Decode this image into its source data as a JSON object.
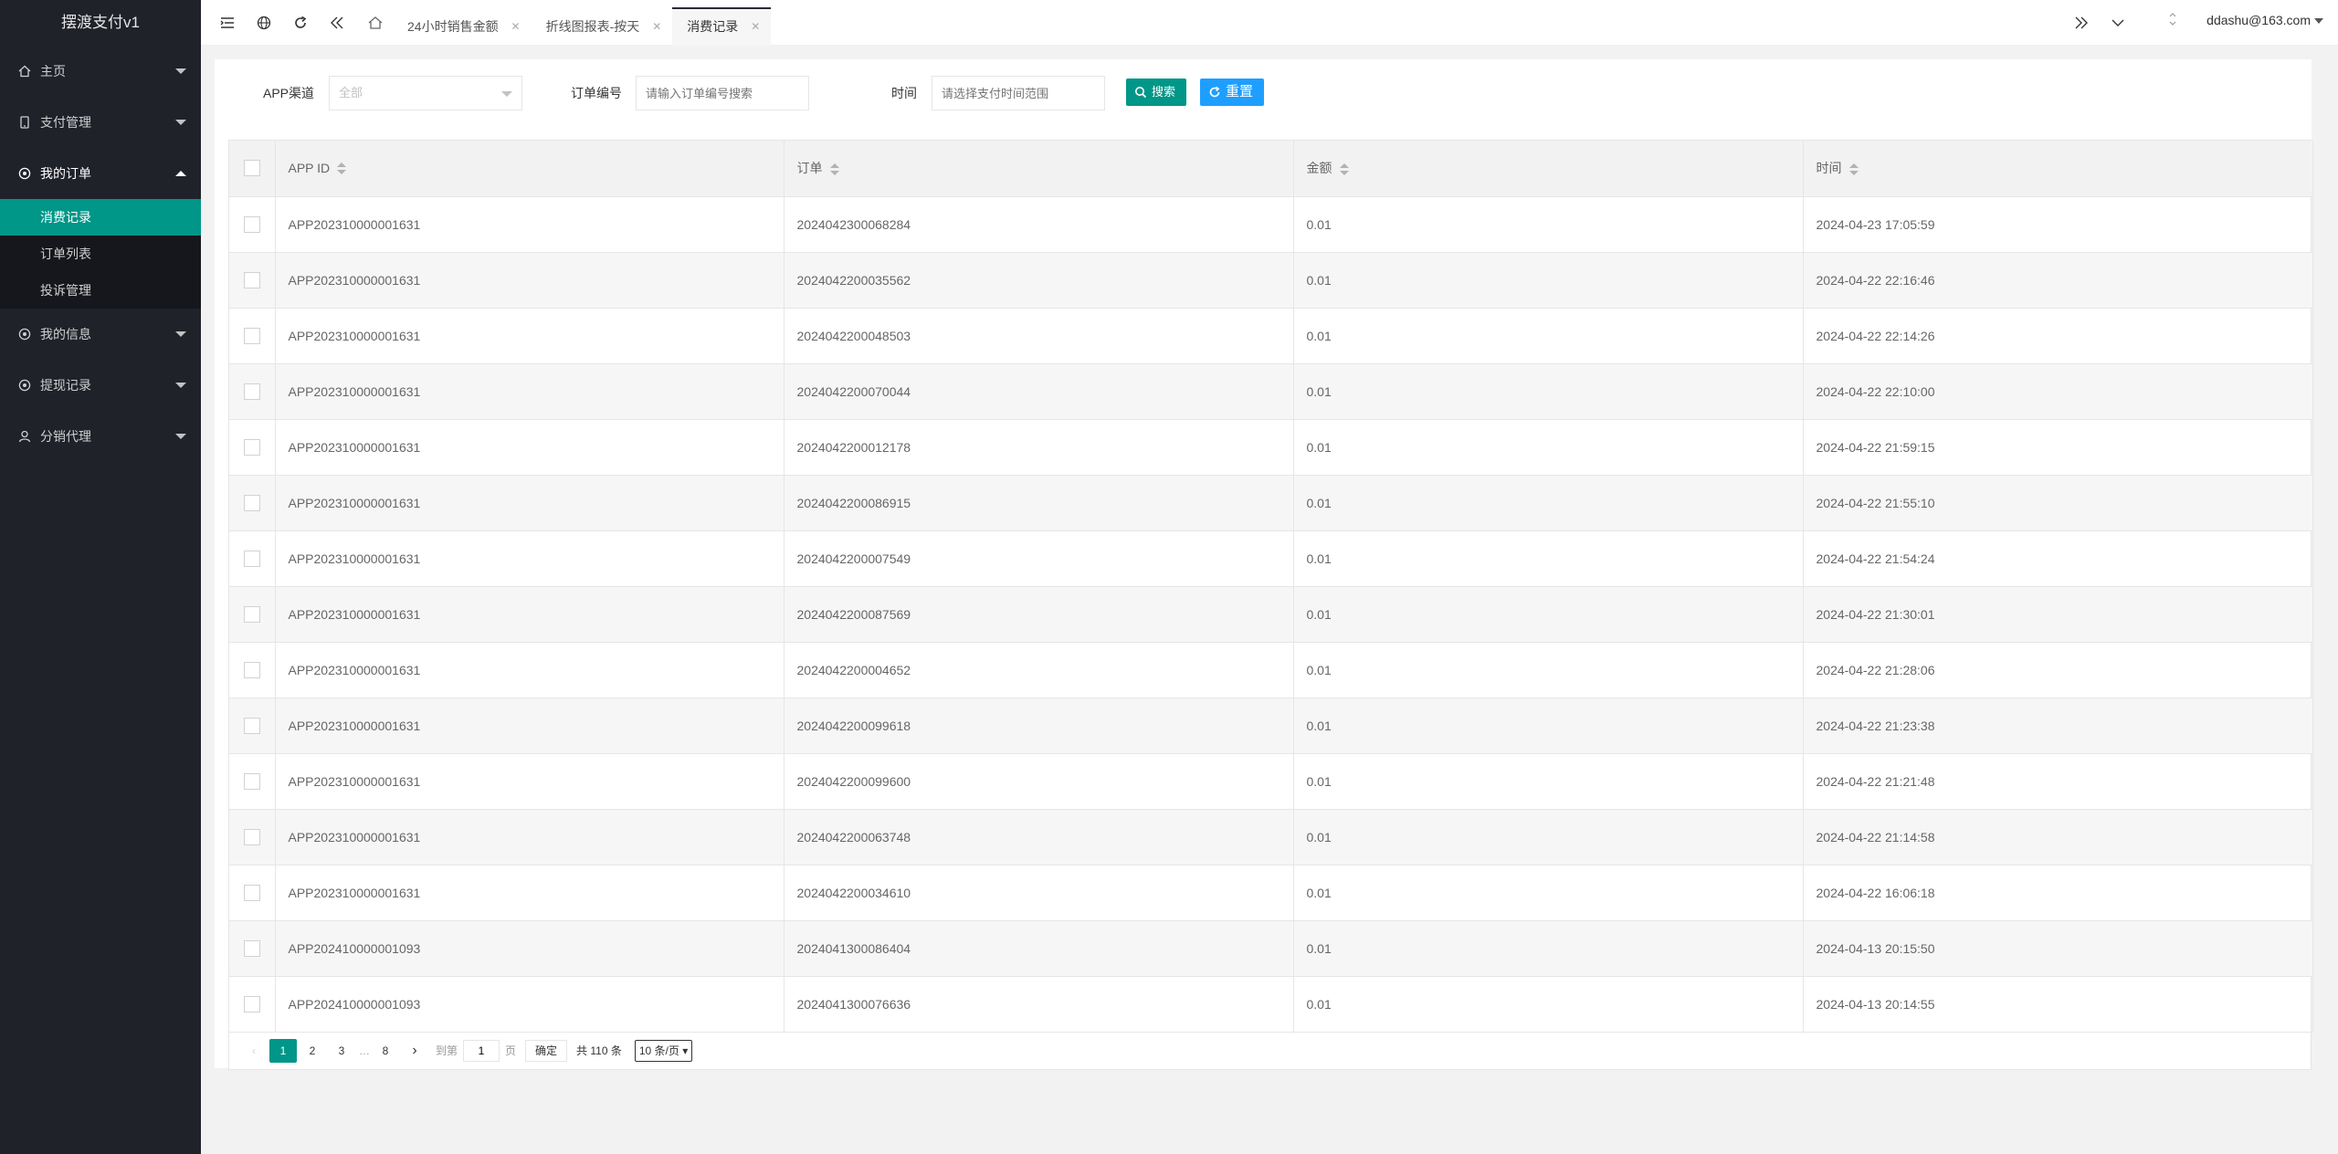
{
  "app": {
    "title": "摆渡支付v1"
  },
  "sidebar": {
    "items": [
      {
        "label": "主页",
        "icon": "home-icon"
      },
      {
        "label": "支付管理",
        "icon": "phone-icon"
      },
      {
        "label": "我的订单",
        "icon": "settings-icon",
        "open": true,
        "children": [
          {
            "label": "消费记录",
            "active": true
          },
          {
            "label": "订单列表"
          },
          {
            "label": "投诉管理"
          }
        ]
      },
      {
        "label": "我的信息",
        "icon": "settings-icon"
      },
      {
        "label": "提现记录",
        "icon": "settings-icon"
      },
      {
        "label": "分销代理",
        "icon": "user-icon"
      }
    ]
  },
  "header": {
    "tabs": [
      {
        "label": "24小时销售金额"
      },
      {
        "label": "折线图报表-按天"
      },
      {
        "label": "消费记录",
        "active": true
      }
    ],
    "user": "ddashu@163.com"
  },
  "filter": {
    "channel_label": "APP渠道",
    "channel_value": "全部",
    "order_label": "订单编号",
    "order_placeholder": "请输入订单编号搜索",
    "time_label": "时间",
    "time_placeholder": "请选择支付时间范围",
    "search_label": "搜索",
    "reset_label": "重置"
  },
  "table": {
    "columns": [
      "APP ID",
      "订单",
      "金额",
      "时间"
    ],
    "rows": [
      [
        "APP202310000001631",
        "2024042300068284",
        "0.01",
        "2024-04-23 17:05:59"
      ],
      [
        "APP202310000001631",
        "2024042200035562",
        "0.01",
        "2024-04-22 22:16:46"
      ],
      [
        "APP202310000001631",
        "2024042200048503",
        "0.01",
        "2024-04-22 22:14:26"
      ],
      [
        "APP202310000001631",
        "2024042200070044",
        "0.01",
        "2024-04-22 22:10:00"
      ],
      [
        "APP202310000001631",
        "2024042200012178",
        "0.01",
        "2024-04-22 21:59:15"
      ],
      [
        "APP202310000001631",
        "2024042200086915",
        "0.01",
        "2024-04-22 21:55:10"
      ],
      [
        "APP202310000001631",
        "2024042200007549",
        "0.01",
        "2024-04-22 21:54:24"
      ],
      [
        "APP202310000001631",
        "2024042200087569",
        "0.01",
        "2024-04-22 21:30:01"
      ],
      [
        "APP202310000001631",
        "2024042200004652",
        "0.01",
        "2024-04-22 21:28:06"
      ],
      [
        "APP202310000001631",
        "2024042200099618",
        "0.01",
        "2024-04-22 21:23:38"
      ],
      [
        "APP202310000001631",
        "2024042200099600",
        "0.01",
        "2024-04-22 21:21:48"
      ],
      [
        "APP202310000001631",
        "2024042200063748",
        "0.01",
        "2024-04-22 21:14:58"
      ],
      [
        "APP202310000001631",
        "2024042200034610",
        "0.01",
        "2024-04-22 16:06:18"
      ],
      [
        "APP202410000001093",
        "2024041300086404",
        "0.01",
        "2024-04-13 20:15:50"
      ],
      [
        "APP202410000001093",
        "2024041300076636",
        "0.01",
        "2024-04-13 20:14:55"
      ]
    ]
  },
  "pager": {
    "pages": [
      "1",
      "2",
      "3"
    ],
    "ellipsis": "…",
    "last_page": "8",
    "goto_label": "到第",
    "goto_value": "1",
    "page_unit": "页",
    "confirm_label": "确定",
    "total_text": "共 110 条",
    "page_size": "10 条/页"
  },
  "colors": {
    "sidebar_bg": "#20222a",
    "accent": "#009688",
    "reset_btn": "#1e9fff"
  }
}
